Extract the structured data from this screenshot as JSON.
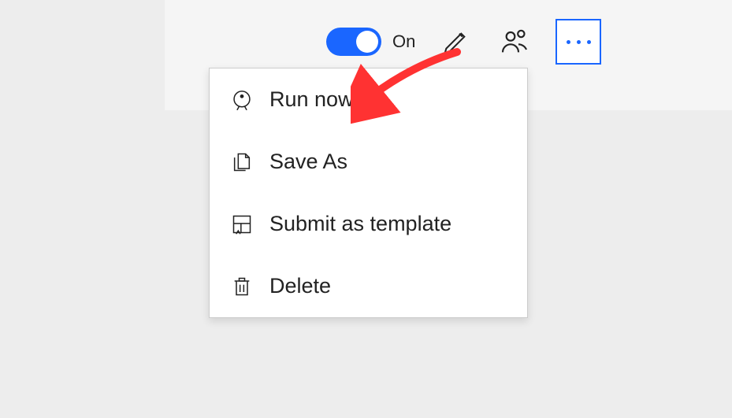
{
  "toolbar": {
    "toggle_label": "On",
    "toggle_state": true
  },
  "menu": {
    "items": [
      {
        "label": "Run now"
      },
      {
        "label": "Save As"
      },
      {
        "label": "Submit as template"
      },
      {
        "label": "Delete"
      }
    ]
  },
  "colors": {
    "accent": "#1a66ff",
    "arrow": "#ff3232"
  }
}
